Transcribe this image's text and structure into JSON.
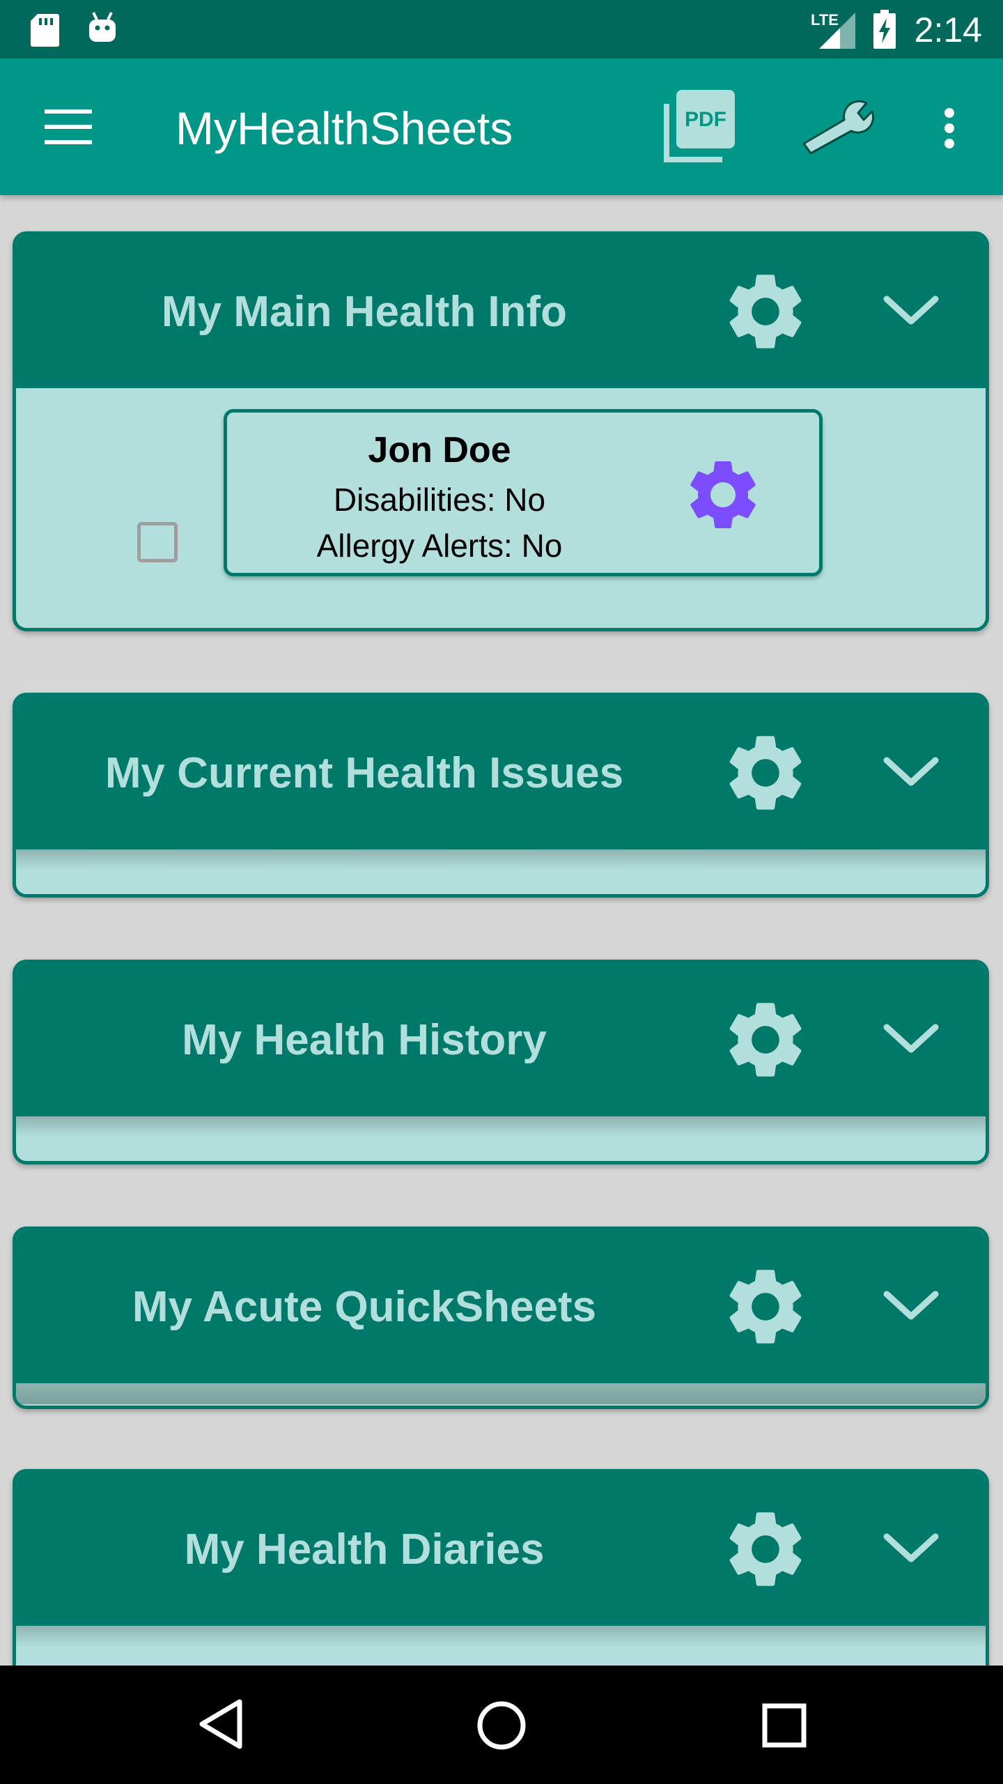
{
  "status_bar": {
    "time": "2:14",
    "network": "LTE",
    "icons": [
      "sd-card-icon",
      "android-icon",
      "signal-icon",
      "battery-charging-icon"
    ]
  },
  "toolbar": {
    "title": "MyHealthSheets",
    "pdf_label": "PDF",
    "icons": [
      "menu-icon",
      "pdf-icon",
      "wrench-icon",
      "more-vert-icon"
    ]
  },
  "colors": {
    "primary_dark": "#00695c",
    "primary": "#009688",
    "section_header": "#00796b",
    "section_body": "#b2dfdb",
    "accent_gear": "#7c4dff"
  },
  "sections": [
    {
      "title": "My Main Health Info",
      "expanded": true,
      "patient": {
        "name": "Jon Doe",
        "disabilities": "Disabilities: No",
        "allergy_alerts": "Allergy Alerts: No"
      }
    },
    {
      "title": "My Current Health Issues",
      "expanded": false
    },
    {
      "title": "My Health History",
      "expanded": false
    },
    {
      "title": "My Acute QuickSheets",
      "expanded": false
    },
    {
      "title": "My Health Diaries",
      "expanded": false
    }
  ],
  "nav_bar": {
    "icons": [
      "back-icon",
      "home-icon",
      "recents-icon"
    ]
  }
}
